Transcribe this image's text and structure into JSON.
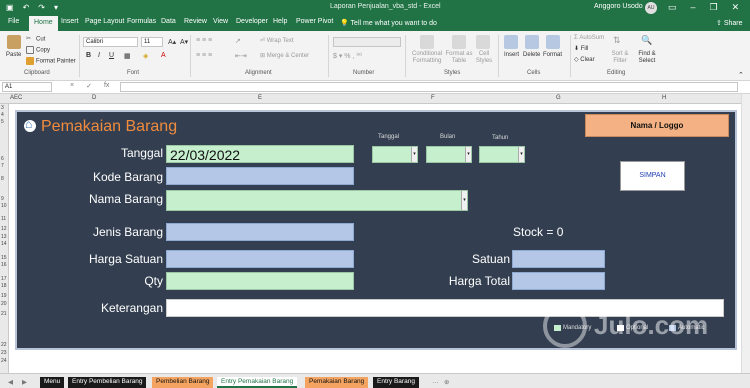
{
  "window": {
    "title": "Laporan Penjualan_vba_std  -  Excel",
    "user": "Anggoro Usodo",
    "user_initials": "AU",
    "share": "Share",
    "accent": "#217346"
  },
  "ribbon_tabs": [
    "File",
    "Home",
    "Insert",
    "Page Layout",
    "Formulas",
    "Data",
    "Review",
    "View",
    "Developer",
    "Help",
    "Power Pivot"
  ],
  "tell_me": "Tell me what you want to do",
  "ribbon": {
    "clipboard": {
      "label": "Clipboard",
      "paste": "Paste",
      "cut": "Cut",
      "copy": "Copy",
      "format_painter": "Format Painter"
    },
    "font": {
      "label": "Font",
      "name": "Calibri",
      "size": "11"
    },
    "alignment": {
      "label": "Alignment",
      "wrap": "Wrap Text",
      "merge": "Merge & Center"
    },
    "number": {
      "label": "Number"
    },
    "styles": {
      "label": "Styles",
      "conditional": "Conditional Formatting",
      "format_table": "Format as Table",
      "cell_styles": "Cell Styles"
    },
    "cells": {
      "label": "Cells",
      "insert": "Insert",
      "delete": "Delete",
      "format": "Format"
    },
    "editing": {
      "label": "Editing",
      "autosum": "AutoSum",
      "fill": "Fill",
      "clear": "Clear",
      "sort": "Sort & Filter",
      "find": "Find & Select"
    }
  },
  "formula_bar": {
    "name_box": "A1",
    "icons": [
      "×",
      "✓",
      "fx"
    ]
  },
  "columns": [
    "AEC",
    "D",
    "E",
    "F",
    "G",
    "H"
  ],
  "rows": [
    "3",
    "4",
    "5",
    "6",
    "7",
    "8",
    "9",
    "10",
    "11",
    "12",
    "13",
    "14",
    "15",
    "16",
    "17",
    "18",
    "19",
    "20",
    "21",
    "22",
    "23",
    "24"
  ],
  "form": {
    "title": "Pemakaian Barang",
    "labels": {
      "tanggal": "Tanggal",
      "kode_barang": "Kode Barang",
      "nama_barang": "Nama Barang",
      "jenis_barang": "Jenis Barang",
      "harga_satuan": "Harga Satuan",
      "qty": "Qty",
      "keterangan": "Keterangan",
      "satuan": "Satuan",
      "harga_total": "Harga Total",
      "small_tanggal": "Tanggal",
      "small_bulan": "Bulan",
      "small_tahun": "Tahun"
    },
    "values": {
      "tanggal": "22/03/2022",
      "kode_barang": "",
      "nama_barang": "",
      "jenis_barang": "",
      "harga_satuan": "",
      "qty": "",
      "keterangan": "",
      "satuan": "",
      "harga_total": ""
    },
    "stock": "Stock = 0",
    "logo_box": "Nama / Loggo",
    "save_button": "SIMPAN",
    "legend": [
      "Mandatory",
      "Optional",
      "Automatic"
    ],
    "colors": {
      "mandatory": "#c6efce",
      "optional": "#ffffff",
      "automatic": "#b4c7e7",
      "background": "#333f50",
      "title": "#f08a3c"
    }
  },
  "watermark": "Julo.com",
  "sheet_tabs": [
    {
      "label": "Menu",
      "color": "#1a1a1a"
    },
    {
      "label": "Entry Pembelian Barang",
      "color": "#1a1a1a"
    },
    {
      "label": "Pembelian Barang",
      "color": "#f4a460"
    },
    {
      "label": "Entry Pemakaian Barang",
      "color": "#ffffff"
    },
    {
      "label": "Pemakaian Barang",
      "color": "#f4a460"
    },
    {
      "label": "Entry Barang",
      "color": "#1a1a1a"
    }
  ]
}
